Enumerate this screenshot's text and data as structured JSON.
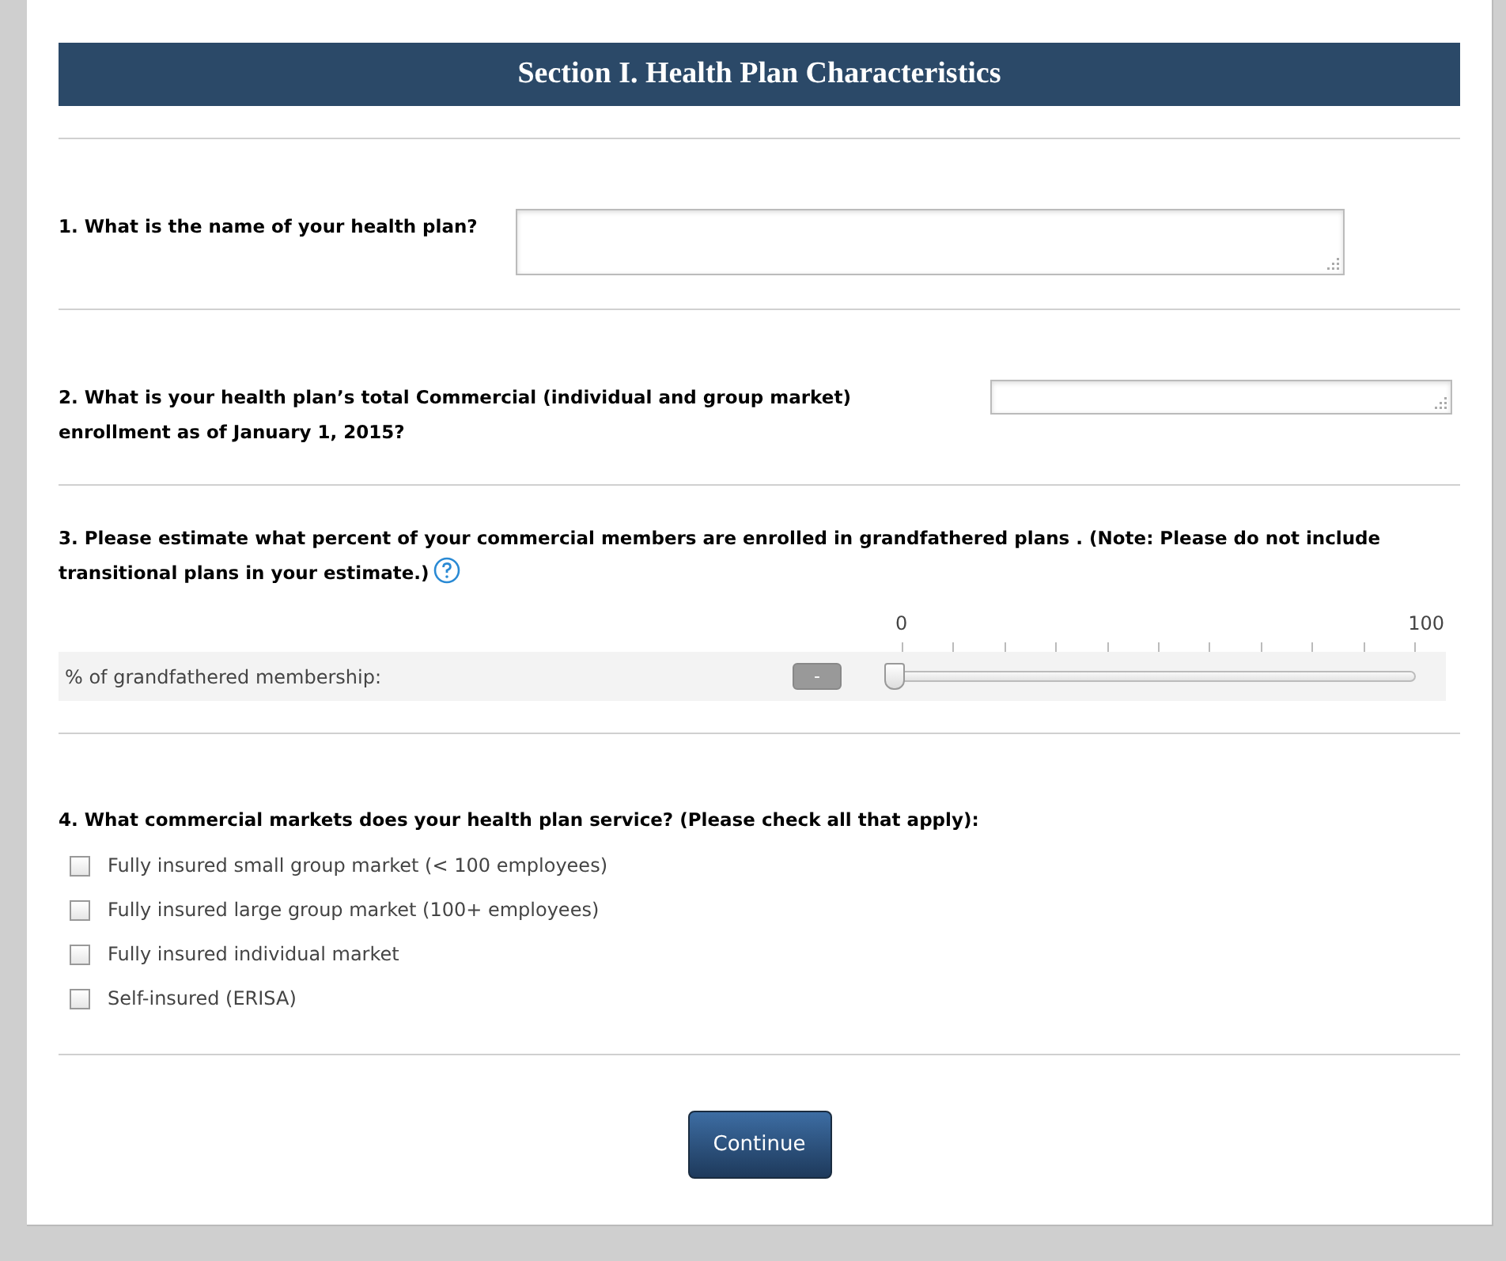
{
  "section_title": "Section I. Health Plan Characteristics",
  "questions": [
    {
      "kind": "text",
      "label": "1. What is the name of your health plan?"
    },
    {
      "kind": "number",
      "label": "2. What is your health plan’s total Commercial (individual and group market) enrollment as of January 1, 2015?"
    },
    {
      "kind": "slider",
      "label": "3. Please estimate what percent of your commercial members are enrolled in grandfathered plans . (Note: Please do not include transitional plans in your estimate.)",
      "help": true,
      "scale_min": "0",
      "scale_max": "100",
      "row_label": "% of grandfathered membership:",
      "button": "-",
      "level": 0
    },
    {
      "kind": "checkboxes",
      "label": "4. What commercial markets does your health plan service? (Please check all that apply):",
      "options": [
        {
          "label": "Fully insured small group market (< 100 employees)",
          "checked": false
        },
        {
          "label": "Fully insured large group market (100+ employees)",
          "checked": false
        },
        {
          "label": "Fully insured individual market",
          "checked": false
        },
        {
          "label": "Self-insured (ERISA)",
          "checked": false
        }
      ]
    }
  ],
  "continue_button": "Continue"
}
